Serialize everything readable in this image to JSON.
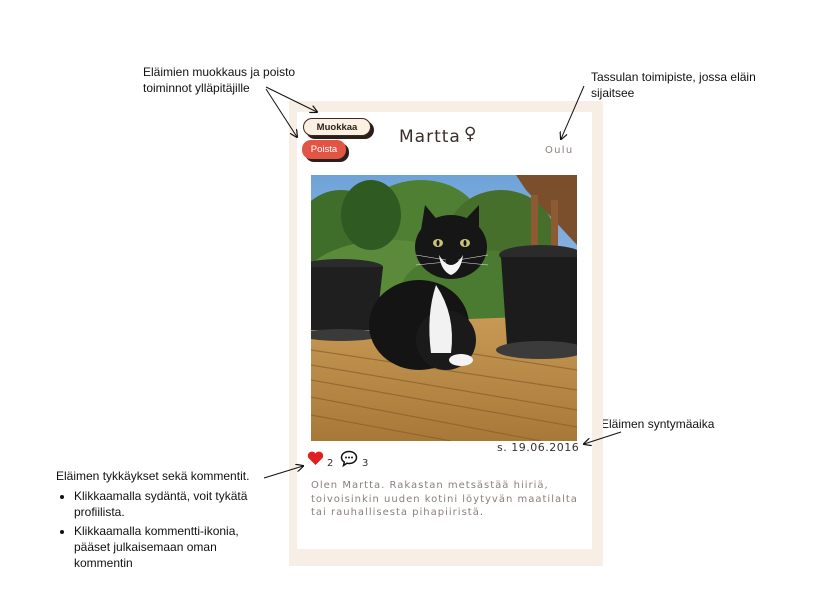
{
  "annotations": {
    "admin": "Eläimien muokkaus ja poisto toiminnot ylläpitäjille",
    "location": "Tassulan toimipiste, jossa eläin sijaitsee",
    "birthdate": "Eläimen syntymäaika",
    "likes": {
      "heading": "Eläimen tykkäykset sekä kommentit.",
      "items": [
        "Klikkaamalla sydäntä, voit tykätä profiilista.",
        "Klikkaamalla kommentti-ikonia, pääset julkaisemaan oman kommentin"
      ]
    }
  },
  "card": {
    "edit_label": "Muokkaa",
    "delete_label": "Poista",
    "name": "Martta",
    "gender_symbol": "♀",
    "location": "Oulu",
    "birthdate": "s. 19.06.2016",
    "likes": "2",
    "comments": "3",
    "description": "Olen Martta. Rakastan metsästää hiiriä, toivoisinkin uuden kotini löytyvän maatilalta tai rauhallisesta pihapiiristä."
  },
  "colors": {
    "delete_button": "#e25545",
    "edit_button": "#fbf0e2",
    "card_border": "#f7eee6",
    "heart": "#e02020"
  },
  "icons": [
    "heart-icon",
    "comment-icon",
    "female-icon"
  ]
}
